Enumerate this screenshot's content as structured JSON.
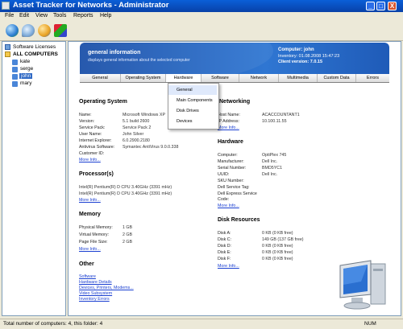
{
  "window": {
    "title": "Asset Tracker for Networks - Administrator",
    "min": "_",
    "max": "□",
    "close": "X"
  },
  "menu": [
    "File",
    "Edit",
    "View",
    "Tools",
    "Reports",
    "Help"
  ],
  "tree": {
    "licenses": "Software Licenses",
    "all": "ALL COMPUTERS",
    "computers": [
      "kate",
      "serge",
      "john",
      "mary"
    ]
  },
  "header": {
    "title": "general information",
    "subtitle": "displays general information about the selected computer",
    "computer": "Computer: john",
    "inventory": "Inventory: 01.08.2008 15:47:23",
    "client": "Client version: 7.0.15"
  },
  "tabs": [
    "General",
    "Operating System",
    "Hardware",
    "Software",
    "Network",
    "Multimedia",
    "Custom Data",
    "Errors"
  ],
  "dropdown": [
    "General",
    "Main Components",
    "Disk Drives",
    "Devices"
  ],
  "os": {
    "title": "Operating System",
    "rows": [
      [
        "Name:",
        "Microsoft Windows XP"
      ],
      [
        "Version:",
        "5.1 build 2600"
      ],
      [
        "Service Pack:",
        "Service Pack 2"
      ],
      [
        "User Name:",
        "John Silver"
      ],
      [
        "Internet Explorer:",
        "6.0.2900.2180"
      ],
      [
        "Antivirus Software:",
        "Symantec AntiVirus 9.0.0.338"
      ],
      [
        "Customer ID:",
        ""
      ]
    ],
    "more": "More Info..."
  },
  "processor": {
    "title": "Processor(s)",
    "items": [
      "Intel(R) Pentium(R) D CPU 3.40GHz (3391 mHz)",
      "Intel(R) Pentium(R) D CPU 3.40GHz (3391 mHz)"
    ],
    "more": "More Info..."
  },
  "memory": {
    "title": "Memory",
    "rows": [
      [
        "Physical Memory:",
        "1 GB"
      ],
      [
        "Virtual Memory:",
        "2 GB"
      ],
      [
        "Page File Size:",
        "2 GB"
      ]
    ],
    "more": "More Info..."
  },
  "other": {
    "title": "Other",
    "links": [
      "Software",
      "Hardware Details",
      "Devices, Printers, Modems...",
      "Video Subsystem",
      "Inventory Errors"
    ]
  },
  "networking": {
    "title": "Networking",
    "rows": [
      [
        "Host Name:",
        "ACACCOUNTANT1"
      ],
      [
        "IP Address:",
        "10.100.11.55"
      ]
    ],
    "more": "More Info..."
  },
  "hardware": {
    "title": "Hardware",
    "rows": [
      [
        "Computer:",
        "OptiPlex 745"
      ],
      [
        "Manufacturer:",
        "Dell Inc."
      ],
      [
        "Serial Number:",
        "BMD5YC1"
      ],
      [
        "UUID:",
        "Dell Inc."
      ],
      [
        "SKU Number:",
        ""
      ],
      [
        "Dell Service Tag:",
        ""
      ],
      [
        "Dell Express Service",
        ""
      ],
      [
        "Code:",
        ""
      ]
    ],
    "more": "More Info..."
  },
  "disk": {
    "title": "Disk Resources",
    "rows": [
      [
        "Disk A:",
        "0 KB (0 KB free)"
      ],
      [
        "Disk C:",
        "149 GB (137 GB free)"
      ],
      [
        "Disk D:",
        "0 KB (0 KB free)"
      ],
      [
        "Disk E:",
        "0 KB (0 KB free)"
      ],
      [
        "Disk F:",
        "0 KB (0 KB free)"
      ]
    ],
    "more": "More Info..."
  },
  "status": {
    "left": "Total number of computers: 4, this folder: 4",
    "right": "NUM"
  }
}
